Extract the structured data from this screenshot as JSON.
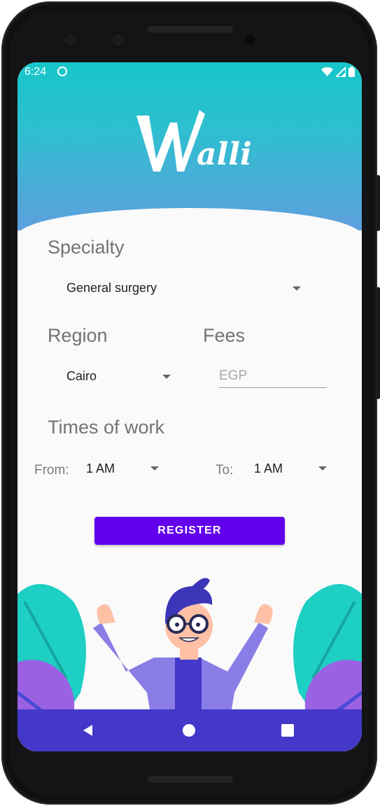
{
  "status_bar": {
    "time": "6:24"
  },
  "app": {
    "logo_text": "Walli"
  },
  "form": {
    "specialty": {
      "label": "Specialty",
      "value": "General surgery"
    },
    "region": {
      "label": "Region",
      "value": "Cairo"
    },
    "fees": {
      "label": "Fees",
      "placeholder": "EGP"
    },
    "times_of_work": {
      "label": "Times of work",
      "from_label": "From:",
      "from_value": "1 AM",
      "to_label": "To:",
      "to_value": "1 AM"
    },
    "register_label": "REGISTER"
  },
  "colors": {
    "accent": "#6200ee",
    "header_top": "#17c6c8",
    "header_bottom": "#5f9fde",
    "nav_bar": "#4338ca"
  },
  "icons": [
    "wifi-icon",
    "signal-icon",
    "battery-icon",
    "back-icon",
    "home-icon",
    "recents-icon",
    "dropdown-arrow-icon"
  ]
}
